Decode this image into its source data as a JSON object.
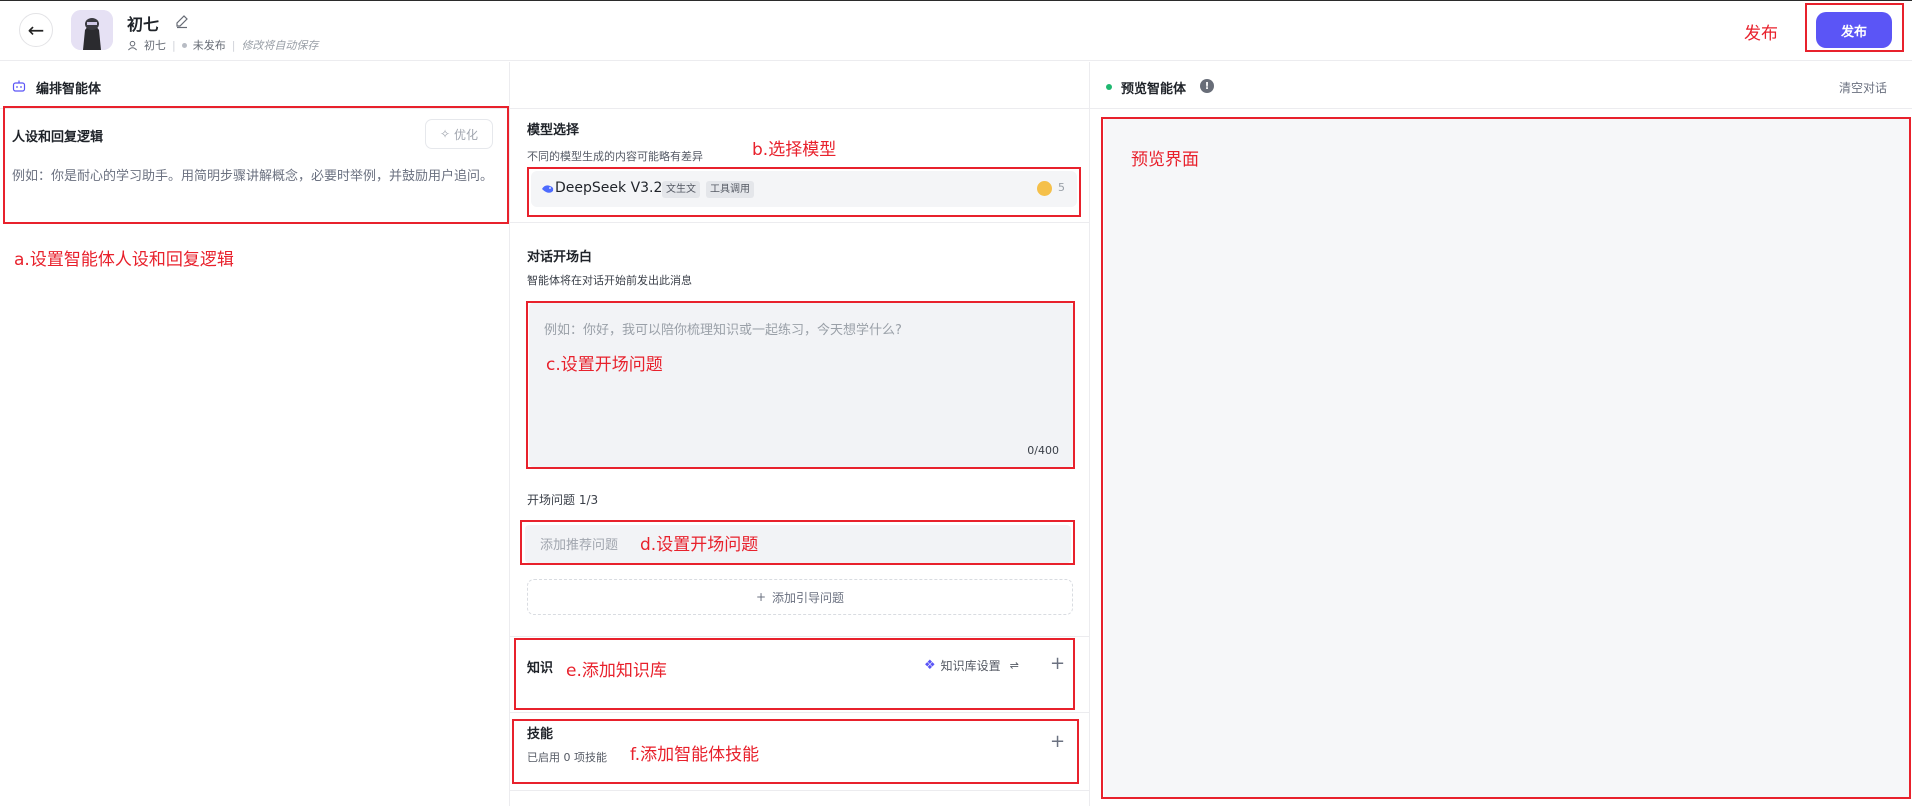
{
  "header": {
    "back_icon": "arrow-left-icon",
    "agent_name": "初七",
    "owner": "初七",
    "status": "未发布",
    "autosave": "修改将自动保存",
    "publish_label": "发布"
  },
  "editor": {
    "title": "编排智能体",
    "persona": {
      "title": "人设和回复逻辑",
      "optimize_label": "优化",
      "placeholder": "例如：你是耐心的学习助手。用简明步骤讲解概念，必要时举例，并鼓励用户追问。"
    },
    "model": {
      "title": "模型选择",
      "subtitle": "不同的模型生成的内容可能略有差异",
      "name": "DeepSeek V3.2",
      "tags": [
        "文生文",
        "工具调用"
      ],
      "count": "5"
    },
    "opening": {
      "title": "对话开场白",
      "subtitle": "智能体将在对话开始前发出此消息",
      "placeholder": "例如：你好，我可以陪你梳理知识或一起练习，今天想学什么?",
      "counter": "0/400"
    },
    "opening_questions": {
      "title": "开场问题 1/3",
      "placeholder": "添加推荐问题",
      "add_label": "添加引导问题"
    },
    "knowledge": {
      "title": "知识",
      "settings_label": "知识库设置"
    },
    "skills": {
      "title": "技能",
      "subtitle": "已启用 0 项技能"
    }
  },
  "preview": {
    "title": "预览智能体",
    "clear_label": "清空对话"
  },
  "annotations": {
    "publish": "发布",
    "a": "a.设置智能体人设和回复逻辑",
    "b": "b.选择模型",
    "c": "c.设置开场问题",
    "d": "d.设置开场问题",
    "e": "e.添加知识库",
    "f": "f.添加智能体技能",
    "preview": "预览界面"
  },
  "colors": {
    "accent": "#5b55f6",
    "annotation_red": "#e8212c",
    "status_green": "#1fb870"
  }
}
